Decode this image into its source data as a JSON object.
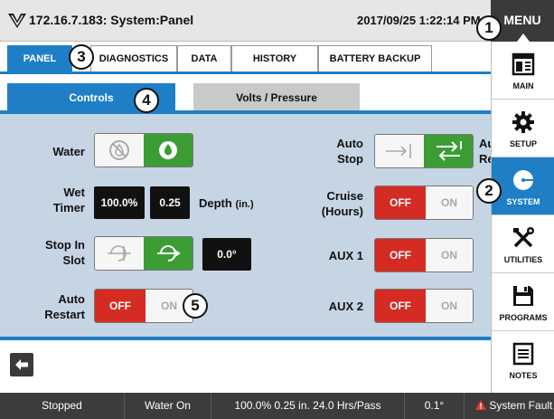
{
  "titlebar": {
    "title": "172.16.7.183: System:Panel",
    "datetime": "2017/09/25 1:22:14 PM",
    "menu_label": "MENU"
  },
  "tabs": [
    {
      "label": "PANEL",
      "active": true
    },
    {
      "label": "DIAGNOSTICS",
      "active": false
    },
    {
      "label": "DATA",
      "active": false
    },
    {
      "label": "HISTORY",
      "active": false
    },
    {
      "label": "BATTERY BACKUP",
      "active": false
    }
  ],
  "subtabs": [
    {
      "label": "Controls",
      "active": true
    },
    {
      "label": "Volts / Pressure",
      "active": false
    }
  ],
  "controls": {
    "water": {
      "label": "Water"
    },
    "wet_timer": {
      "label": "Wet\nTimer",
      "percent": "100.0%",
      "depth": "0.25",
      "depth_label": "Depth",
      "depth_unit": "(in.)"
    },
    "stop_in_slot": {
      "label": "Stop In\nSlot",
      "value": "0.0°"
    },
    "auto_restart": {
      "label": "Auto\nRestart",
      "off": "OFF",
      "on": "ON",
      "state": "OFF"
    },
    "auto_stop": {
      "label": "Auto\nStop",
      "right_cut": "Au\nRe"
    },
    "cruise": {
      "label": "Cruise\n(Hours)",
      "off": "OFF",
      "on": "ON",
      "state": "OFF"
    },
    "aux1": {
      "label": "AUX 1",
      "off": "OFF",
      "on": "ON",
      "state": "OFF"
    },
    "aux2": {
      "label": "AUX 2",
      "off": "OFF",
      "on": "ON",
      "state": "OFF"
    }
  },
  "sidebar": {
    "items": [
      {
        "label": "MAIN",
        "icon": "main-icon",
        "active": false
      },
      {
        "label": "SETUP",
        "icon": "gear-icon",
        "active": false
      },
      {
        "label": "SYSTEM",
        "icon": "system-icon",
        "active": true
      },
      {
        "label": "UTILITIES",
        "icon": "tools-icon",
        "active": false
      },
      {
        "label": "PROGRAMS",
        "icon": "save-icon",
        "active": false
      },
      {
        "label": "NOTES",
        "icon": "notes-icon",
        "active": false
      }
    ]
  },
  "statusbar": {
    "state": "Stopped",
    "water": "Water On",
    "info": "100.0%  0.25 in.  24.0 Hrs/Pass",
    "angle": "0.1°",
    "fault": "System Fault"
  },
  "callouts": [
    "1",
    "2",
    "3",
    "4",
    "5"
  ],
  "colors": {
    "accent": "#1e7fc7",
    "panel_bg": "#c6d5e3",
    "on_green": "#3b9d34",
    "off_red": "#d42b23",
    "statusbar": "#3c3c3c"
  }
}
